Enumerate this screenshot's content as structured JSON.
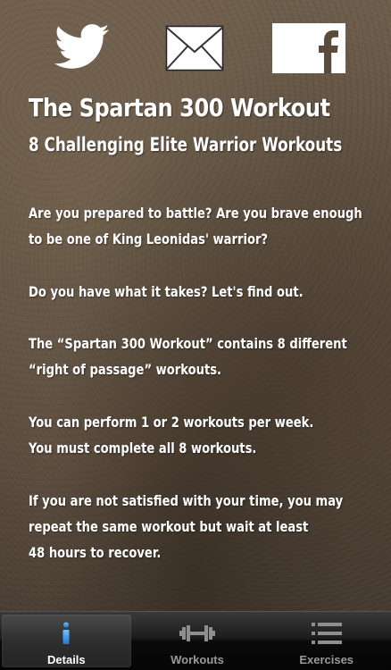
{
  "social": {
    "twitter_icon": "twitter-bird-icon",
    "mail_icon": "envelope-icon",
    "facebook_icon": "facebook-icon"
  },
  "header": {
    "title": "The Spartan 300 Workout",
    "subtitle": "8 Challenging Elite Warrior Workouts"
  },
  "body": {
    "paragraphs": [
      [
        "Are you prepared to battle?  Are you brave enough",
        "to be one of King Leonidas' warrior?"
      ],
      [
        "Do you have what it takes?  Let's find out."
      ],
      [
        "The “Spartan 300 Workout” contains 8 different",
        "“right of passage” workouts."
      ],
      [
        "You can perform 1 or 2 workouts per week.",
        "You must complete all 8 workouts."
      ],
      [
        "If you are not satisfied with your time, you may",
        "repeat the same workout but wait at least",
        "48 hours to recover."
      ]
    ]
  },
  "tabbar": {
    "tabs": [
      {
        "label": "Details",
        "icon": "info-icon",
        "active": true
      },
      {
        "label": "Workouts",
        "icon": "dumbbell-icon",
        "active": false
      },
      {
        "label": "Exercises",
        "icon": "list-icon",
        "active": false
      }
    ]
  },
  "colors": {
    "text": "#ffffff",
    "active_icon": "#2f8fe0",
    "inactive_tab_label": "#9a9a9a"
  }
}
